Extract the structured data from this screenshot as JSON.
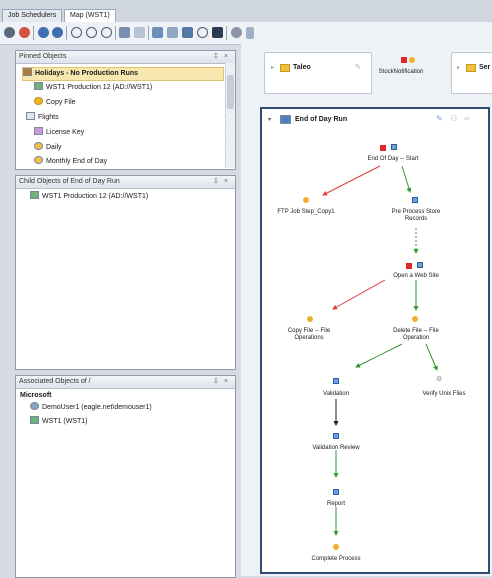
{
  "tabs": [
    {
      "label": "Job Schedulers"
    },
    {
      "label": "Map (WST1)"
    }
  ],
  "pinned": {
    "title": "Pinned Objects",
    "items": [
      {
        "label": "Holidays - No Production Runs"
      },
      {
        "label": "WST1 Production 12 (AD://WST1)"
      },
      {
        "label": "Copy File"
      },
      {
        "label": "Flights"
      },
      {
        "label": "License Key"
      },
      {
        "label": "Daily"
      },
      {
        "label": "Monthly End of Day"
      }
    ]
  },
  "child": {
    "title": "Child Objects of End of Day Run",
    "items": [
      {
        "label": "WST1 Production 12 (AD://WST1)"
      }
    ]
  },
  "assoc": {
    "title": "Associated Objects of /",
    "group": "Microsoft",
    "items": [
      {
        "label": "DemoUser1 (eagle.net\\demouser1)"
      },
      {
        "label": "WST1 (WST1)"
      }
    ]
  },
  "panel_controls": {
    "pin": "‡",
    "close": "×"
  },
  "map": {
    "top_cards": [
      {
        "label": "Taleo"
      },
      {
        "label": "StockNotification"
      },
      {
        "label": "Ser"
      }
    ],
    "group_title": "End of Day Run",
    "nodes": {
      "start": "End Of Day -- Start",
      "ftp": "FTP Job Step_Copy1",
      "pre": "Pre Process Store Records",
      "web": "Open a Web Site",
      "copy": "Copy File -- File Operations",
      "del": "Delete File -- File Operation",
      "val": "Validation",
      "verify": "Verify Unix Files",
      "review": "Validation Review",
      "report": "Report",
      "complete": "Complete Process"
    }
  },
  "colors": {
    "accent": "#2f4a73",
    "success": "#2e9a2e",
    "failure": "#e03c3c",
    "default": "#1a1a1a"
  }
}
